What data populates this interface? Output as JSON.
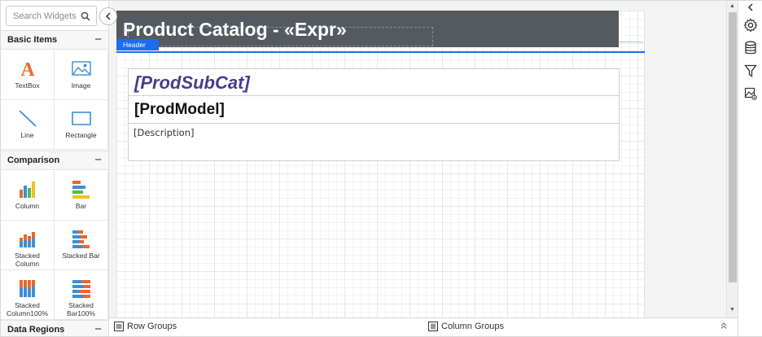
{
  "widget_panel": {
    "search": {
      "placeholder": "Search Widgets"
    },
    "sections": {
      "basic_items": {
        "title": "Basic Items",
        "toggle": "−",
        "items": [
          {
            "label": "TextBox",
            "icon": "textbox-icon"
          },
          {
            "label": "Image",
            "icon": "image-icon"
          },
          {
            "label": "Line",
            "icon": "line-icon"
          },
          {
            "label": "Rectangle",
            "icon": "rectangle-icon"
          }
        ]
      },
      "comparison": {
        "title": "Comparison",
        "toggle": "−",
        "items": [
          {
            "label": "Column",
            "icon": "column-chart-icon"
          },
          {
            "label": "Bar",
            "icon": "bar-chart-icon"
          },
          {
            "label_line1": "Stacked",
            "label_line2": "Column",
            "icon": "stacked-column-icon"
          },
          {
            "label": "Stacked Bar",
            "icon": "stacked-bar-icon"
          },
          {
            "label_line1": "Stacked",
            "label_line2": "Column100%",
            "icon": "stacked-column-100-icon"
          },
          {
            "label_line1": "Stacked",
            "label_line2": "Bar100%",
            "icon": "stacked-bar-100-icon"
          }
        ]
      },
      "data_regions": {
        "title": "Data Regions",
        "toggle": "−"
      }
    }
  },
  "designer": {
    "header": {
      "title": "Product Catalog - «Expr»",
      "tag": "Header"
    },
    "detail": {
      "subcategory": "[ProdSubCat]",
      "model": "[ProdModel]",
      "description": "[Description]"
    }
  },
  "bottom_bar": {
    "row_groups": "Row Groups",
    "column_groups": "Column Groups",
    "expand_icon": "double-chevron-up-icon"
  },
  "right_rail": {
    "collapse_icon": "chevron-left-icon",
    "buttons": [
      "settings-icon",
      "database-icon",
      "filter-icon",
      "image-settings-icon"
    ]
  },
  "colors": {
    "header_band": "#555a60",
    "accent_blue": "#1d6cf0",
    "subcategory_text": "#4b3b8c",
    "textbox_orange": "#e8692a"
  }
}
